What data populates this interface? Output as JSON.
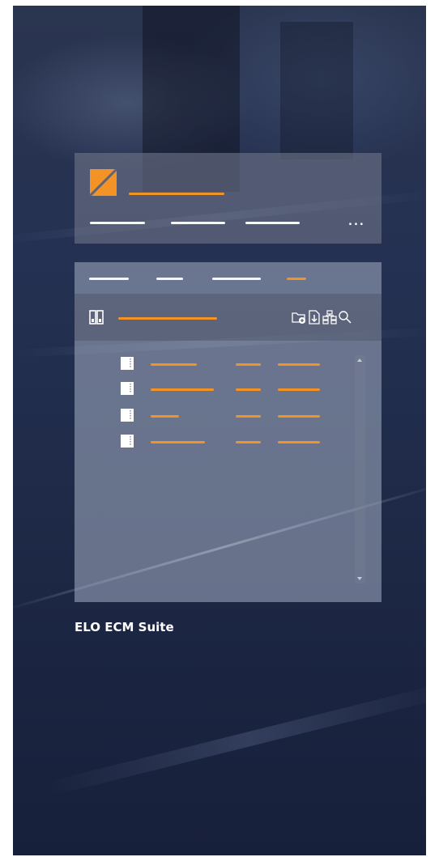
{
  "product": {
    "caption": "ELO ECM Suite"
  },
  "colors": {
    "accent": "#f39325",
    "placeholder_white": "#f4f6fa"
  },
  "header": {
    "logo_icon": "elo-logo-icon",
    "more_icon": "more-horizontal-icon",
    "more_label": "..."
  },
  "toolbar": {
    "icons": [
      "binder-icon",
      "new-folder-icon",
      "download-document-icon",
      "structure-icon",
      "search-icon"
    ]
  },
  "list": {
    "row_icon": "document-icon",
    "row_count": 4
  }
}
